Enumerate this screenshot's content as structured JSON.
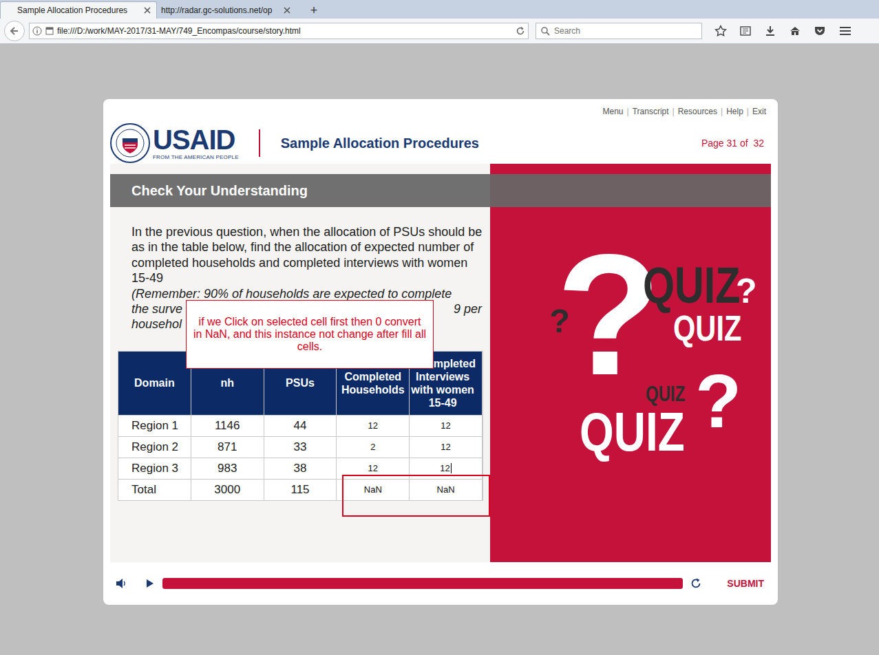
{
  "browser": {
    "tabs": [
      {
        "label": "Sample Allocation Procedures",
        "selected": true
      },
      {
        "label": "http://radar.gc-solutions.net/op",
        "selected": false
      }
    ],
    "new_tab": "+",
    "url": "file:///D:/work/MAY-2017/31-MAY/749_Encompas/course/story.html",
    "search": {
      "placeholder": "Search"
    }
  },
  "player": {
    "top_links": [
      "Menu",
      "Transcript",
      "Resources",
      "Help",
      "Exit"
    ],
    "separator": "|",
    "logo": {
      "word": "USAID",
      "tagline": "FROM THE AMERICAN PEOPLE"
    },
    "course_title": "Sample Allocation Procedures",
    "page": "Page 31 of  32",
    "progress": {
      "level": 1
    },
    "submit": "SUBMIT"
  },
  "slide": {
    "heading": "Check Your Understanding",
    "question": "In the previous question, when the allocation of PSUs should be as in the table below, find the allocation of expected number of completed households and completed interviews with women 15-49",
    "remember_lines": [
      [
        "(Remember: 90% of households are expected to complete"
      ],
      [
        "the surve",
        "9 per"
      ],
      [
        "househol"
      ]
    ],
    "table": {
      "columns": [
        {
          "lines": [
            "Domain"
          ],
          "clipped": false
        },
        {
          "lines": [
            "nh"
          ],
          "clipped": false
        },
        {
          "lines": [
            "PSUs"
          ],
          "clipped": false
        },
        {
          "lines": [
            "Completed",
            "Households"
          ],
          "clipped": false
        },
        {
          "lines": [
            "mpleted",
            "Interviews",
            "with women",
            "15-49"
          ],
          "clipped": true
        }
      ],
      "rows": [
        {
          "domain": "Region 1",
          "nh": "1146",
          "psus": "44",
          "cells": [
            {
              "value": "12",
              "focused": false
            },
            {
              "value": "12",
              "focused": false
            }
          ]
        },
        {
          "domain": "Region 2",
          "nh": "871",
          "psus": "33",
          "cells": [
            {
              "value": "2",
              "focused": false
            },
            {
              "value": "12",
              "focused": false
            }
          ]
        },
        {
          "domain": "Region 3",
          "nh": "983",
          "psus": "38",
          "cells": [
            {
              "value": "12",
              "focused": false
            },
            {
              "value": "12",
              "focused": true
            }
          ]
        }
      ],
      "total": {
        "domain": "Total",
        "nh": "3000",
        "psus": "115",
        "cells": [
          {
            "value": "NaN"
          },
          {
            "value": "NaN"
          }
        ],
        "flagged": true
      }
    },
    "annotation": "if we Click on selected cell first then 0 convert in NaN, and this instance not change after fill all cells.",
    "quiz_art": [
      {
        "text": "?",
        "kind": "white"
      },
      {
        "text": "QUIZ",
        "kind": "dark"
      },
      {
        "text": "?",
        "kind": "white"
      },
      {
        "text": "QUIZ",
        "kind": "white"
      },
      {
        "text": "?",
        "kind": "dark"
      },
      {
        "text": "QUIZ",
        "kind": "dark"
      },
      {
        "text": "?",
        "kind": "white"
      },
      {
        "text": "QUIZ",
        "kind": "white"
      }
    ]
  }
}
